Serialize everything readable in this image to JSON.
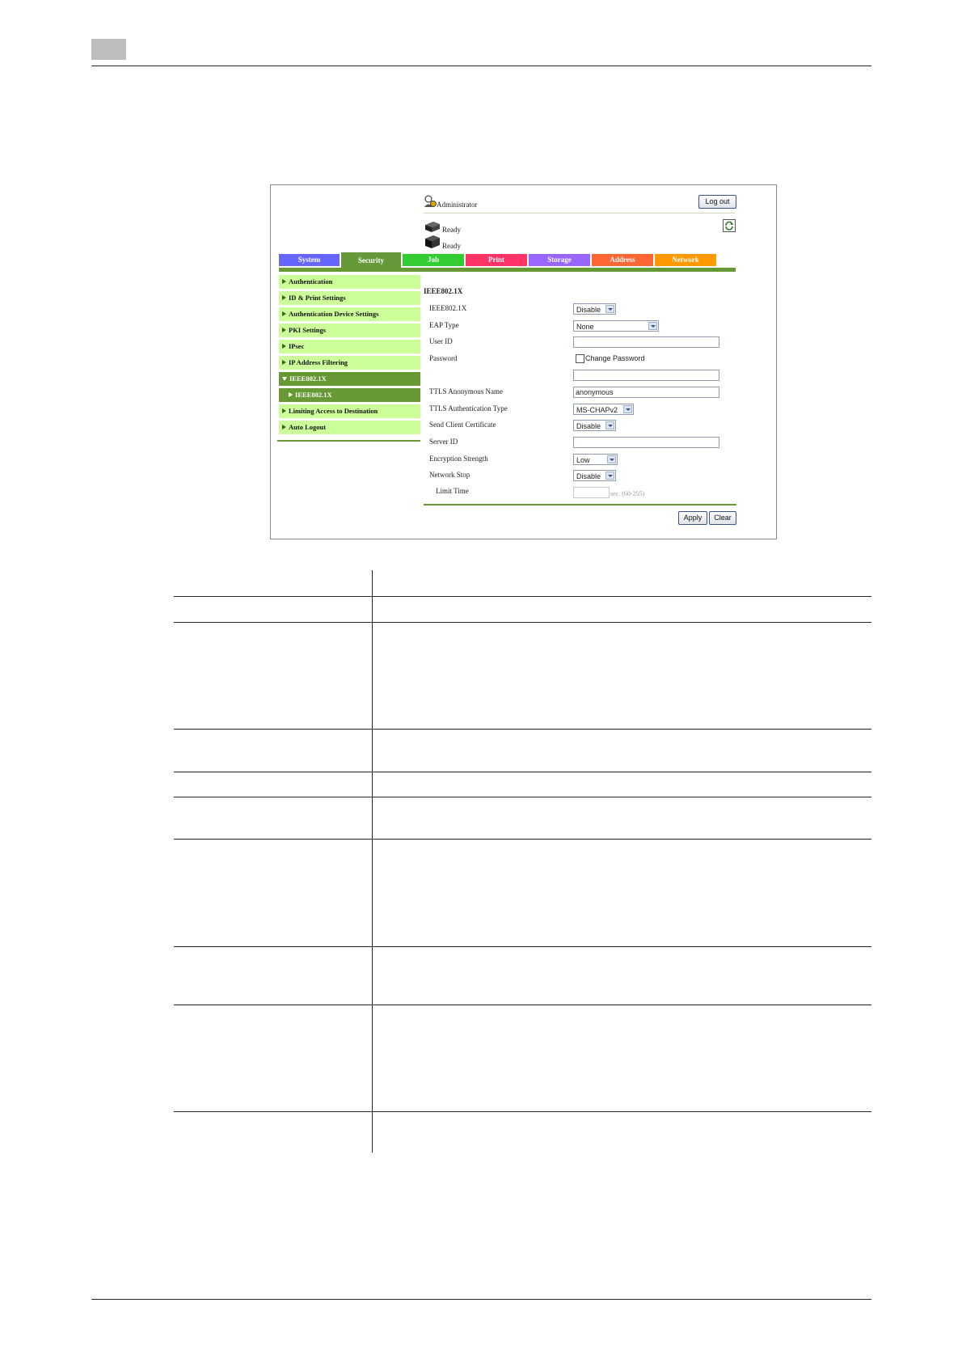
{
  "admin": {
    "label": "Administrator",
    "logout": "Log out"
  },
  "status": {
    "printer1": "Ready",
    "printer2": "Ready"
  },
  "tabs": [
    {
      "label": "System",
      "color": "#6666ff"
    },
    {
      "label": "Security",
      "color": "#66993a"
    },
    {
      "label": "Job",
      "color": "#33cc33"
    },
    {
      "label": "Print",
      "color": "#ff3366"
    },
    {
      "label": "Storage",
      "color": "#9966ff"
    },
    {
      "label": "Address",
      "color": "#ff6633"
    },
    {
      "label": "Network",
      "color": "#ff9900"
    }
  ],
  "sidebar": {
    "items": [
      "Authentication",
      "ID & Print Settings",
      "Authentication Device Settings",
      "PKI Settings",
      "IPsec",
      "IP Address Filtering",
      "IEEE802.1X",
      "IEEE802.1X",
      "Limiting Access to Destination",
      "Auto Logout"
    ]
  },
  "form": {
    "title": "IEEE802.1X",
    "ieee_label": "IEEE802.1X",
    "ieee_value": "Disable",
    "eap_label": "EAP Type",
    "eap_value": "None",
    "userid_label": "User ID",
    "password_label": "Password",
    "change_password": "Change Password",
    "ttls_anon_label": "TTLS Anonymous Name",
    "ttls_anon_value": "anonymous",
    "ttls_auth_label": "TTLS Authentication Type",
    "ttls_auth_value": "MS-CHAPv2",
    "send_cert_label": "Send Client Certificate",
    "send_cert_value": "Disable",
    "serverid_label": "Server ID",
    "enc_label": "Encryption Strength",
    "enc_value": "Low",
    "netstop_label": "Network Stop",
    "netstop_value": "Disable",
    "limit_label": "Limit Time",
    "limit_unit": "sec. (60-255)",
    "apply": "Apply",
    "clear": "Clear"
  }
}
